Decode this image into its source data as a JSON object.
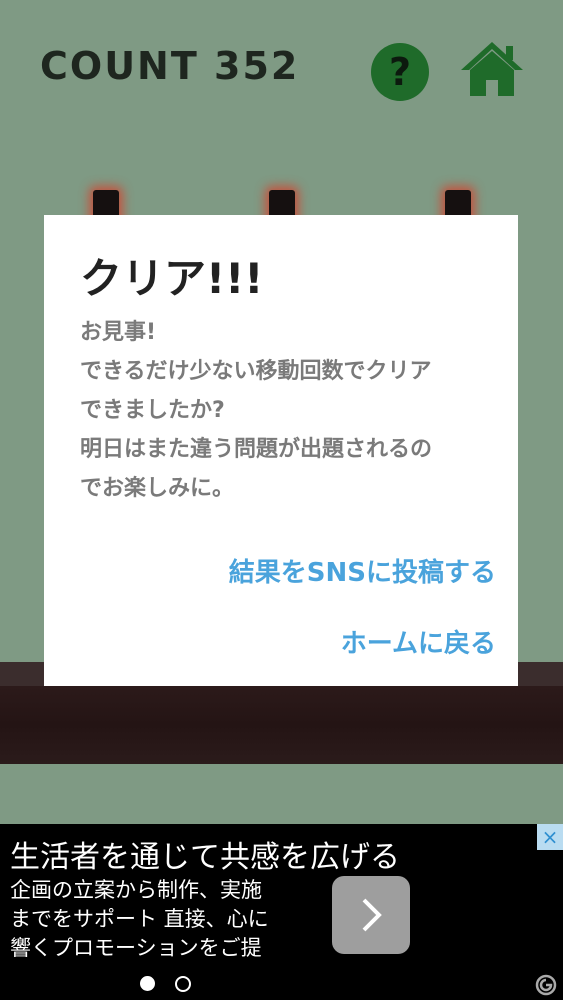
{
  "header": {
    "count_text": "COUNT 352",
    "help_label": "?"
  },
  "icons": {
    "help": "question-icon",
    "home": "home-icon"
  },
  "colors": {
    "background": "#7f9a84",
    "button_green": "#1f6b2a",
    "link_blue": "#4aa3dc",
    "peg_glow": "#d83c28"
  },
  "dialog": {
    "title": "クリア!!!",
    "body_lines": [
      "お見事!",
      "できるだけ少ない移動回数でクリア",
      "できましたか?",
      "明日はまた違う問題が出題されるの",
      "でお楽しみに。"
    ],
    "share_label": "結果をSNSに投稿する",
    "home_label": "ホームに戻る"
  },
  "ad": {
    "headline": "生活者を通じて共感を広げる",
    "description_lines": [
      "企画の立案から制作、実施",
      "までをサポート 直接、心に",
      "響くプロモーションをご提"
    ],
    "close_label": "×",
    "page_indicator": {
      "current": 1,
      "total": 2
    }
  }
}
